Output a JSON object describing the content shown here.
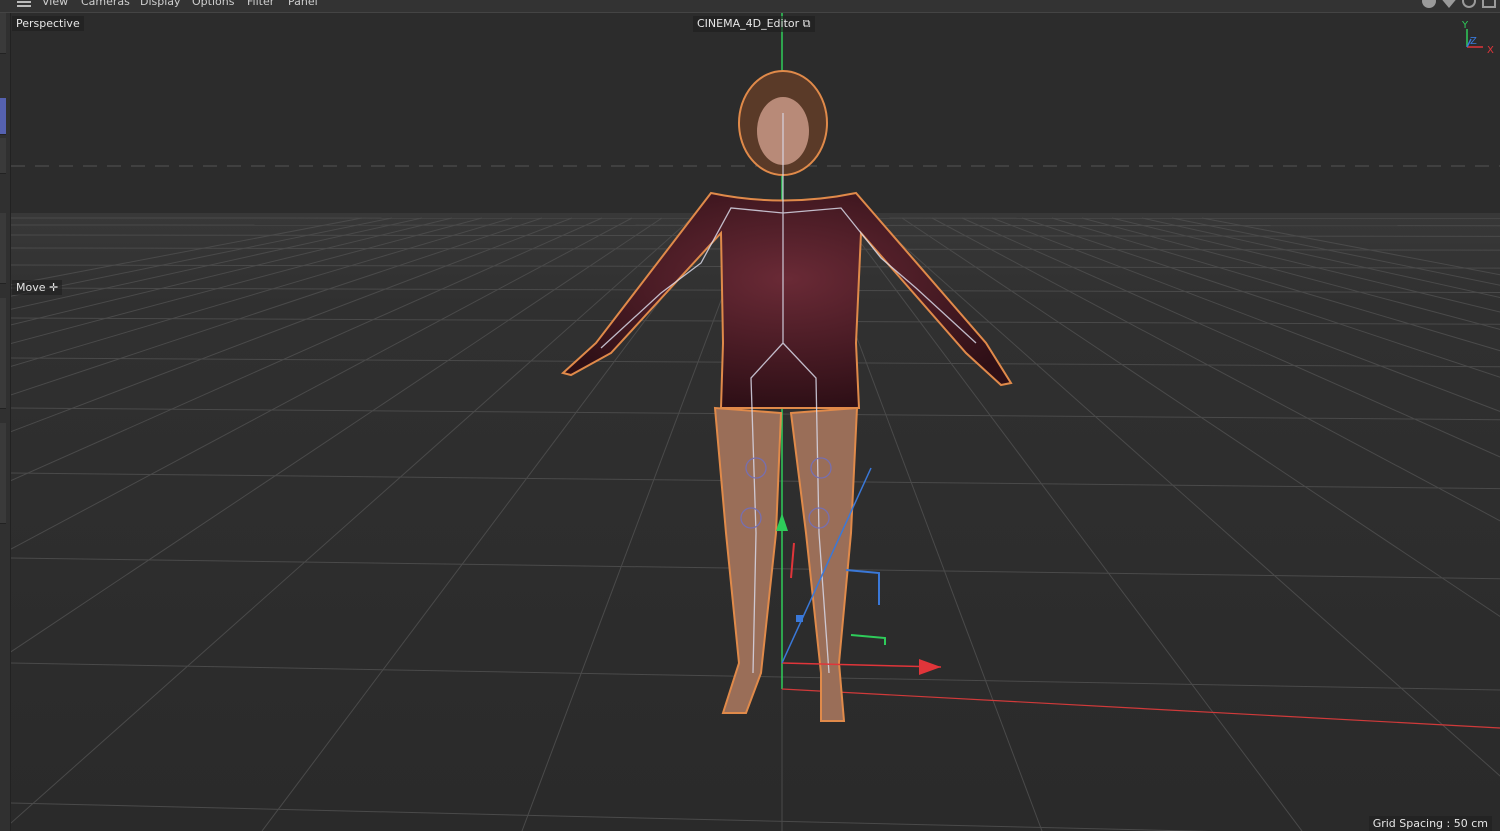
{
  "menu": {
    "items": [
      "View",
      "Cameras",
      "Display",
      "Options",
      "Filter",
      "Panel"
    ]
  },
  "viewport": {
    "camera_label": "Perspective",
    "title": "CINEMA_4D_Editor",
    "tool_label": "Move",
    "tool_icon": "move-cross-icon",
    "grid_spacing": "Grid Spacing : 50 cm",
    "axis_labels": {
      "y": "Y",
      "z": "Z",
      "x": "X"
    }
  },
  "colors": {
    "x_axis": "#e0353a",
    "y_axis": "#2ecc5a",
    "z_axis": "#3a78d8",
    "highlight": "#e08a4a",
    "left_tab_active": "#5561b0"
  }
}
